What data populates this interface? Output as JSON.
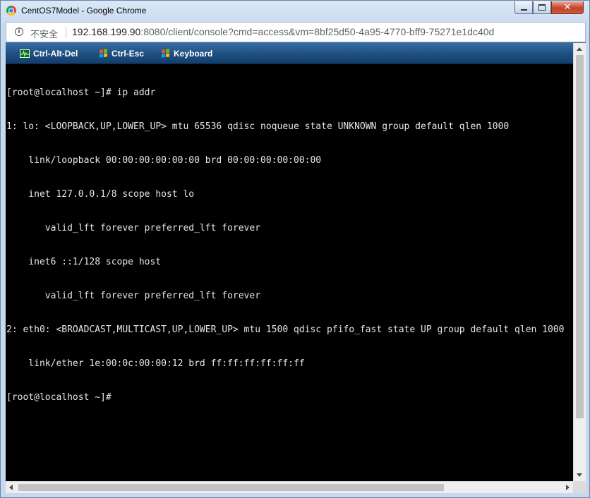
{
  "window": {
    "title": "CentOS7Model - Google Chrome",
    "controls": {
      "minimize_icon": "minimize-icon",
      "maximize_icon": "maximize-icon",
      "close_icon": "close-icon",
      "close_glyph": "✕"
    }
  },
  "address_bar": {
    "info_glyph": "i",
    "security_label": "不安全",
    "url_host": "192.168.199.90",
    "url_rest": ":8080/client/console?cmd=access&vm=8bf25d50-4a95-4770-bff9-75271e1dc40d"
  },
  "toolbar": {
    "buttons": [
      {
        "label": "Ctrl-Alt-Del",
        "icon": "monitor-icon"
      },
      {
        "label": "Ctrl-Esc",
        "icon": "windows-logo-icon"
      },
      {
        "label": "Keyboard",
        "icon": "windows-logo-icon"
      }
    ]
  },
  "console": {
    "lines": [
      "[root@localhost ~]# ip addr",
      "1: lo: <LOOPBACK,UP,LOWER_UP> mtu 65536 qdisc noqueue state UNKNOWN group default qlen 1000",
      "    link/loopback 00:00:00:00:00:00 brd 00:00:00:00:00:00",
      "    inet 127.0.0.1/8 scope host lo",
      "       valid_lft forever preferred_lft forever",
      "    inet6 ::1/128 scope host",
      "       valid_lft forever preferred_lft forever",
      "2: eth0: <BROADCAST,MULTICAST,UP,LOWER_UP> mtu 1500 qdisc pfifo_fast state UP group default qlen 1000",
      "    link/ether 1e:00:0c:00:00:12 brd ff:ff:ff:ff:ff:ff",
      "[root@localhost ~]# "
    ]
  },
  "colors": {
    "console_bg": "#000000",
    "console_fg": "#e6e6e6",
    "toolbar_bg": "#205183",
    "close_button": "#c4412a"
  }
}
